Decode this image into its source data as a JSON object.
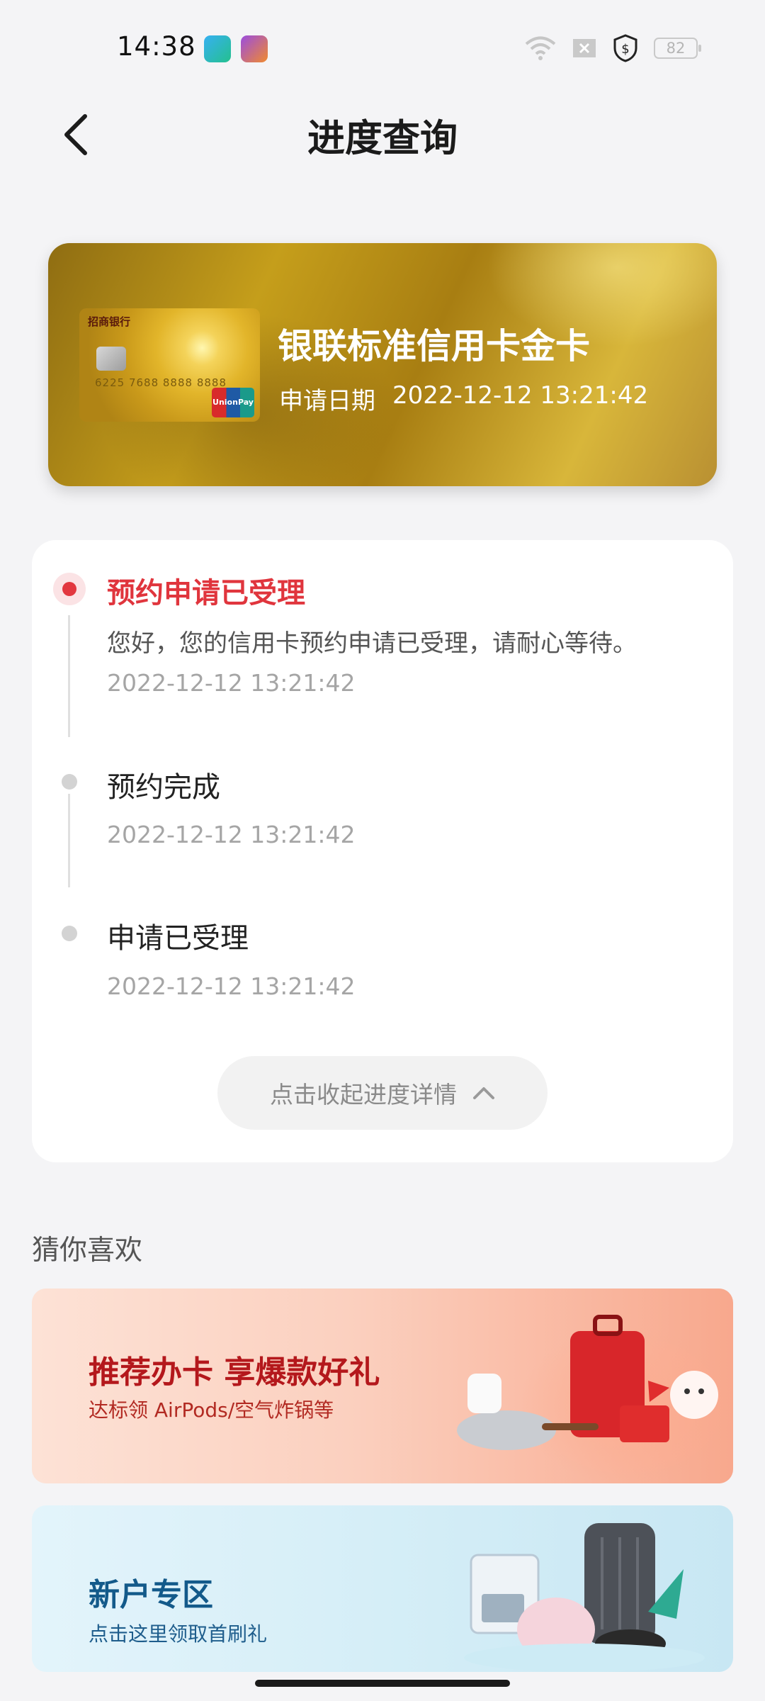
{
  "status_bar": {
    "time": "14:38",
    "battery": "82"
  },
  "header": {
    "title": "进度查询"
  },
  "card": {
    "name": "银联标准信用卡金卡",
    "date_label": "申请日期",
    "date_value": "2022-12-12 13:21:42",
    "mini_bank_name": "招商银行",
    "mini_number": "6225 7688 8888 8888",
    "mini_brand": "UnionPay"
  },
  "progress": {
    "steps": [
      {
        "title": "预约申请已受理",
        "desc": "您好，您的信用卡预约申请已受理，请耐心等待。",
        "time": "2022-12-12 13:21:42",
        "active": true
      },
      {
        "title": "预约完成",
        "time": "2022-12-12 13:21:42",
        "active": false
      },
      {
        "title": "申请已受理",
        "time": "2022-12-12 13:21:42",
        "active": false
      }
    ],
    "collapse_label": "点击收起进度详情"
  },
  "recommend": {
    "title": "猜你喜欢",
    "banners": [
      {
        "title": "推荐办卡 享爆款好礼",
        "subtitle": "达标领 AirPods/空气炸锅等"
      },
      {
        "title": "新户专区",
        "subtitle": "点击这里领取首刷礼"
      }
    ]
  },
  "colors": {
    "accent": "#e0353d",
    "gray_text": "#a5a5a5"
  }
}
